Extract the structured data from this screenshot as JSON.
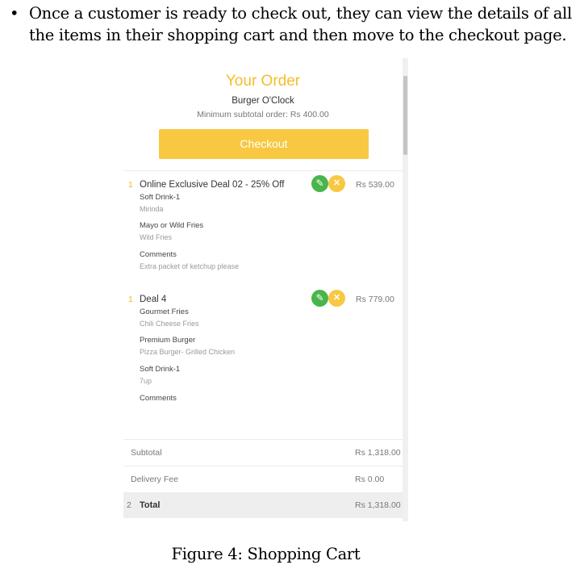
{
  "document": {
    "bullet": "•",
    "intro_line1": "Once a customer is ready to check out, they can view the details of all",
    "intro_line2": "the items in their shopping cart and then move to the checkout page.",
    "caption": "Figure 4: Shopping Cart"
  },
  "cart": {
    "title": "Your Order",
    "restaurant": "Burger O'Clock",
    "minimum_order": "Minimum subtotal order: Rs 400.00",
    "checkout_label": "Checkout",
    "items": [
      {
        "qty": "1",
        "name": "Online Exclusive Deal 02 - 25% Off",
        "price": "Rs 539.00",
        "options": [
          {
            "title": "Soft Drink-1",
            "value": "Mirinda"
          },
          {
            "title": "Mayo or Wild Fries",
            "value": "Wild Fries"
          },
          {
            "title": "Comments",
            "value": "Extra packet of ketchup please"
          }
        ]
      },
      {
        "qty": "1",
        "name": "Deal 4",
        "price": "Rs 779.00",
        "options": [
          {
            "title": "Gourmet Fries",
            "value": "Chili Cheese Fries"
          },
          {
            "title": "Premium Burger",
            "value": "Pizza Burger- Grilled Chicken"
          },
          {
            "title": "Soft Drink-1",
            "value": "7up"
          },
          {
            "title": "Comments",
            "value": ""
          }
        ]
      }
    ],
    "subtotal_label": "Subtotal",
    "subtotal_value": "Rs 1,318.00",
    "delivery_label": "Delivery Fee",
    "delivery_value": "Rs 0.00",
    "total_count": "2",
    "total_label": "Total",
    "total_value": "Rs 1,318.00"
  },
  "icons": {
    "edit": "pencil-icon",
    "remove": "close-icon"
  },
  "colors": {
    "accent": "#f8c842",
    "title": "#f5bd2a",
    "edit": "#49b54b"
  }
}
